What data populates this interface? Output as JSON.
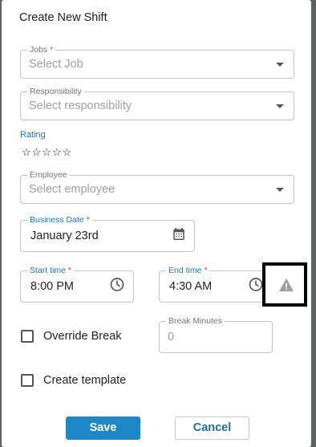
{
  "dialog": {
    "title": "Create New Shift",
    "jobs": {
      "label": "Jobs",
      "required_mark": "*",
      "placeholder": "Select Job"
    },
    "responsibility": {
      "label": "Responsibility",
      "placeholder": "Select responsibility"
    },
    "rating": {
      "label": "Rating",
      "stars": "☆☆☆☆☆",
      "value": 0,
      "max": 5
    },
    "employee": {
      "label": "Employee",
      "placeholder": "Select employee"
    },
    "business_date": {
      "label": "Business Date",
      "required_mark": "*",
      "value": "January 23rd"
    },
    "start_time": {
      "label": "Start time",
      "required_mark": "*",
      "value": "8:00 PM"
    },
    "end_time": {
      "label": "End time",
      "required_mark": "*",
      "value": "4:30 AM"
    },
    "override_break": {
      "label": "Override Break",
      "checked": false
    },
    "break_minutes": {
      "label": "Break Minutes",
      "placeholder": "0"
    },
    "create_template": {
      "label": "Create template",
      "checked": false
    },
    "save_label": "Save",
    "cancel_label": "Cancel"
  },
  "colors": {
    "accent": "#1976d2",
    "save_button": "#1e88c7",
    "required": "#e53935",
    "warning_icon": "#9e9e9e"
  },
  "icons": {
    "dropdown": "caret-down-icon",
    "calendar": "calendar-icon",
    "clock": "clock-icon",
    "warning": "warning-triangle-icon"
  }
}
